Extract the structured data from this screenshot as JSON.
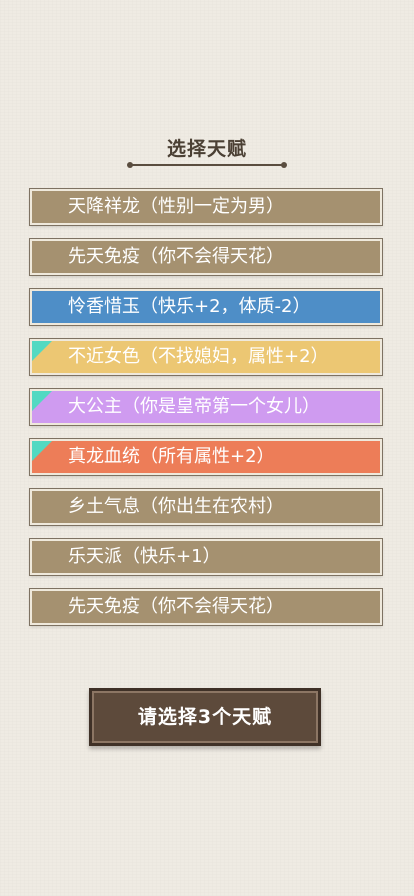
{
  "title": "选择天赋",
  "talents": [
    {
      "label": "天降祥龙（性别一定为男）",
      "bg": "#a59170",
      "corner": false
    },
    {
      "label": "先天免疫（你不会得天花）",
      "bg": "#a59170",
      "corner": false
    },
    {
      "label": "怜香惜玉（快乐+2，体质-2）",
      "bg": "#4e8ec7",
      "corner": false
    },
    {
      "label": "不近女色（不找媳妇，属性+2）",
      "bg": "#ecc773",
      "corner": true
    },
    {
      "label": "大公主（你是皇帝第一个女儿）",
      "bg": "#cf9bf0",
      "corner": true
    },
    {
      "label": "真龙血统（所有属性+2）",
      "bg": "#ed7d58",
      "corner": true
    },
    {
      "label": "乡土气息（你出生在农村）",
      "bg": "#a59170",
      "corner": false
    },
    {
      "label": "乐天派（快乐+1）",
      "bg": "#a59170",
      "corner": false
    },
    {
      "label": "先天免疫（你不会得天花）",
      "bg": "#a59170",
      "corner": false
    }
  ],
  "confirm_button": "请选择3个天赋"
}
